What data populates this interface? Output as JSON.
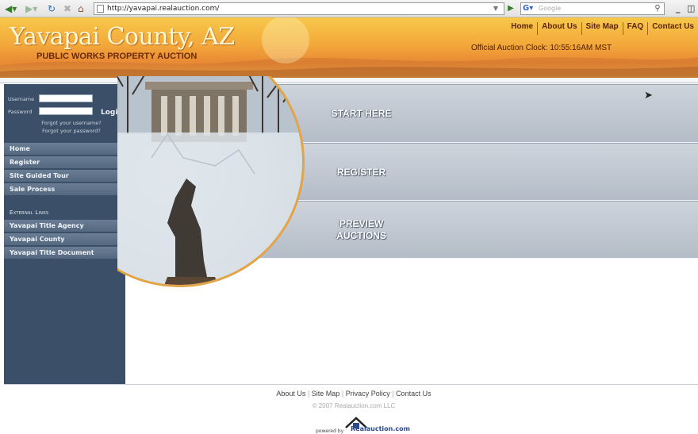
{
  "browser": {
    "url": "http://yavapai.realauction.com/",
    "search_placeholder": "Google",
    "search_engine_icon": "google-g-icon",
    "buttons": [
      "back-icon",
      "forward-icon",
      "refresh-icon",
      "stop-icon",
      "home-icon"
    ]
  },
  "header": {
    "title": "Yavapai County, AZ",
    "subtitle": "PUBLIC WORKS PROPERTY AUCTION",
    "nav": [
      "Home",
      "About Us",
      "Site Map",
      "FAQ",
      "Contact Us"
    ],
    "clock_label": "Official Auction Clock: ",
    "clock_value": "10:55:16AM MST"
  },
  "sidebar": {
    "username_label": "Username",
    "password_label": "Password",
    "login_label": "Login",
    "forgot_username": "Forgot your username?",
    "forgot_password": "Forgot your password?",
    "menu": [
      "Home",
      "Register",
      "Site Guided Tour",
      "Sale Process"
    ],
    "external_heading": "External Links",
    "external_links": [
      "Yavapai Title Agency",
      "Yavapai County",
      "Yavapai Title Document"
    ]
  },
  "main": {
    "panels": [
      {
        "label_line1": "START HERE",
        "label_line2": ""
      },
      {
        "label_line1": "REGISTER",
        "label_line2": ""
      },
      {
        "label_line1": "PREVIEW",
        "label_line2": "AUCTIONS"
      }
    ]
  },
  "footer": {
    "links": [
      "About Us",
      "Site Map",
      "Privacy Policy",
      "Contact Us"
    ],
    "copyright": "© 2007 Realauction.com LLC",
    "powered_by": "powered by",
    "brand": "Realauction.com"
  },
  "colors": {
    "sidebar_bg": "#3c4f68",
    "header_orange": "#f3a93a",
    "panel_gray": "#c4cbd4",
    "circle_border": "#e2a445"
  }
}
